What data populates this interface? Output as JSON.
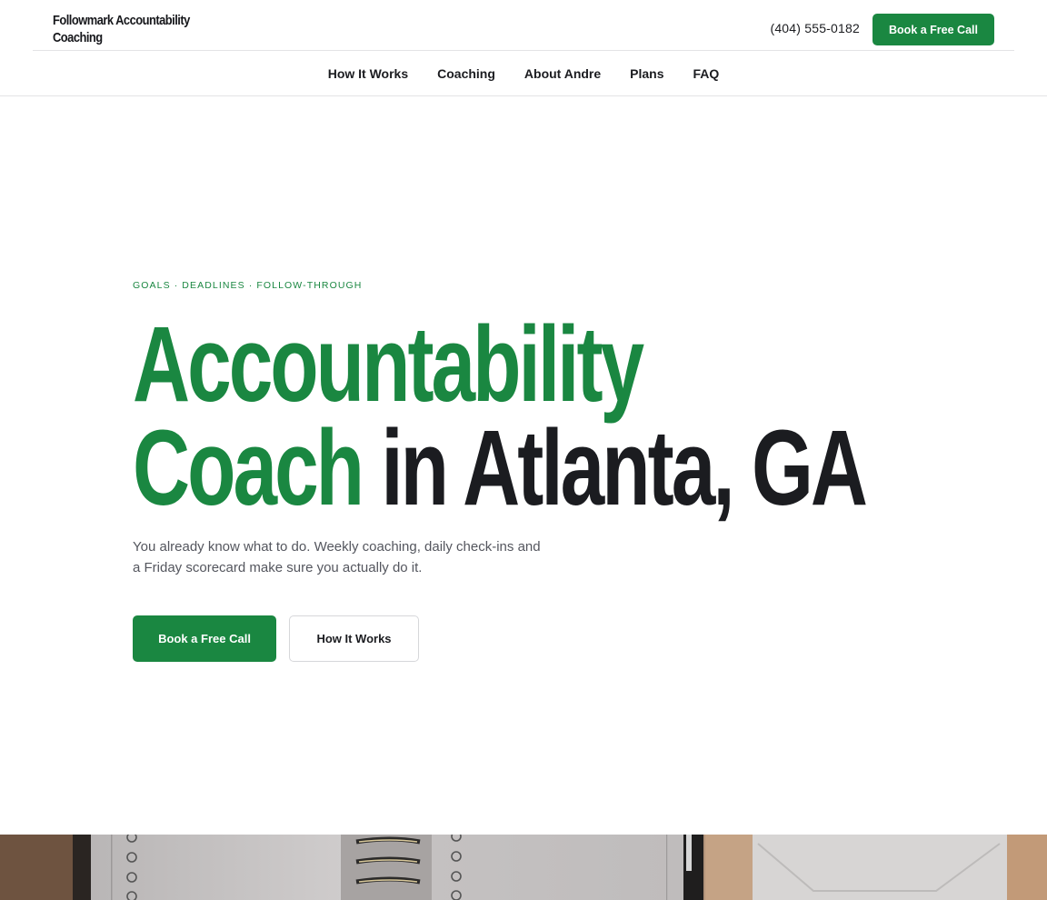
{
  "header": {
    "logo_line1": "Followmark Accountability",
    "logo_line2": "Coaching",
    "phone": "(404) 555-0182",
    "cta_label": "Book a Free Call"
  },
  "nav": {
    "items": [
      "How It Works",
      "Coaching",
      "About Andre",
      "Plans",
      "FAQ"
    ]
  },
  "hero": {
    "eyebrow": "GOALS · DEADLINES · FOLLOW-THROUGH",
    "title_green_1": "Accountability",
    "title_green_2": "Coach",
    "title_dark": "in Atlanta, GA",
    "subtitle": "You already know what to do. Weekly coaching, daily check-ins and a Friday scorecard make sure you actually do it.",
    "primary_cta": "Book a Free Call",
    "secondary_cta": "How It Works"
  },
  "colors": {
    "accent": "#1a8741",
    "text": "#1b1c20",
    "muted": "#54565e"
  }
}
